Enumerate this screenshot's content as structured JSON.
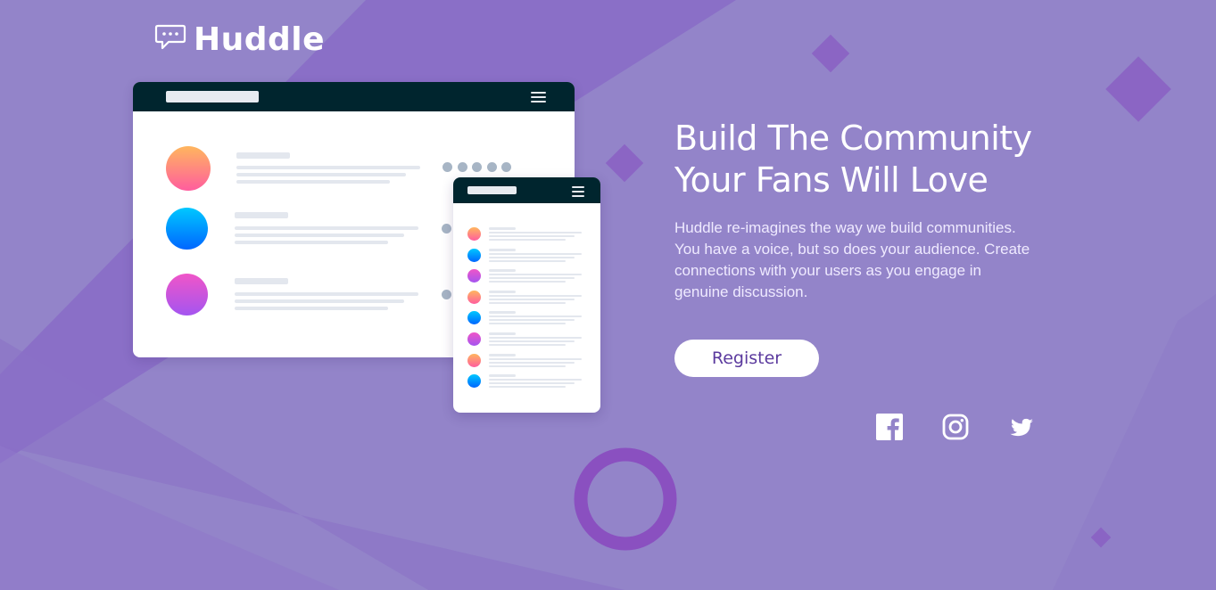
{
  "brand": {
    "name": "Huddle",
    "logo_icon": "speech-bubble-icon"
  },
  "hero": {
    "title_line1": "Build The Community",
    "title_line2": "Your Fans Will Love",
    "description": "Huddle re-imagines the way we build communities. You have a voice, but so does your audience. Create connections with your users as you engage in genuine discussion."
  },
  "cta": {
    "register_label": "Register"
  },
  "social": [
    {
      "name": "facebook-icon"
    },
    {
      "name": "instagram-icon"
    },
    {
      "name": "twitter-icon"
    }
  ],
  "colors": {
    "background": "#9384c9",
    "mockup_bar": "#00252e",
    "button_text": "#5b3a9e",
    "accent_purple": "#8c5cc4"
  }
}
